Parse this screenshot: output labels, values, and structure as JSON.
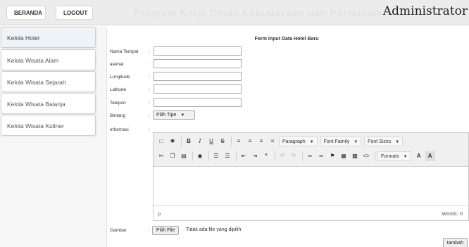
{
  "topbar": {
    "nav": [
      "BERANDA",
      "LOGOUT"
    ],
    "ghost_text": "Program Kerja Dinas Kebudayaan dan Pariwisata",
    "brand": "Administrator"
  },
  "sidebar": {
    "items": [
      {
        "label": "Kelola Hotel",
        "active": true
      },
      {
        "label": "Kelola Wisata Alam",
        "active": false
      },
      {
        "label": "Kelola Wisata Sejarah",
        "active": false
      },
      {
        "label": "Kelola Wisata Balanja",
        "active": false
      },
      {
        "label": "Kelola Wisata Kuliner",
        "active": false
      }
    ]
  },
  "form": {
    "title": "Form Input Data Hotel Baru",
    "colon": ":",
    "fields": [
      {
        "label": "Nama Tempat",
        "value": ""
      },
      {
        "label": "alamat",
        "value": ""
      },
      {
        "label": "Longitude",
        "value": ""
      },
      {
        "label": "Latitude",
        "value": ""
      },
      {
        "label": "Telepon",
        "value": ""
      }
    ],
    "bintang": {
      "label": "Bintang",
      "selected": "Pilih Tipe"
    },
    "informasi": {
      "label": "Informasi"
    },
    "editor": {
      "dropdowns": [
        "Paragraph",
        "Font Family",
        "Font Sizes",
        "Formats"
      ],
      "path": "p",
      "word_count": "Words: 0"
    },
    "gambar": {
      "label": "Gambar",
      "button": "Pilih File",
      "status": "Tidak ada file yang dipilih"
    },
    "submit": "tambah"
  }
}
